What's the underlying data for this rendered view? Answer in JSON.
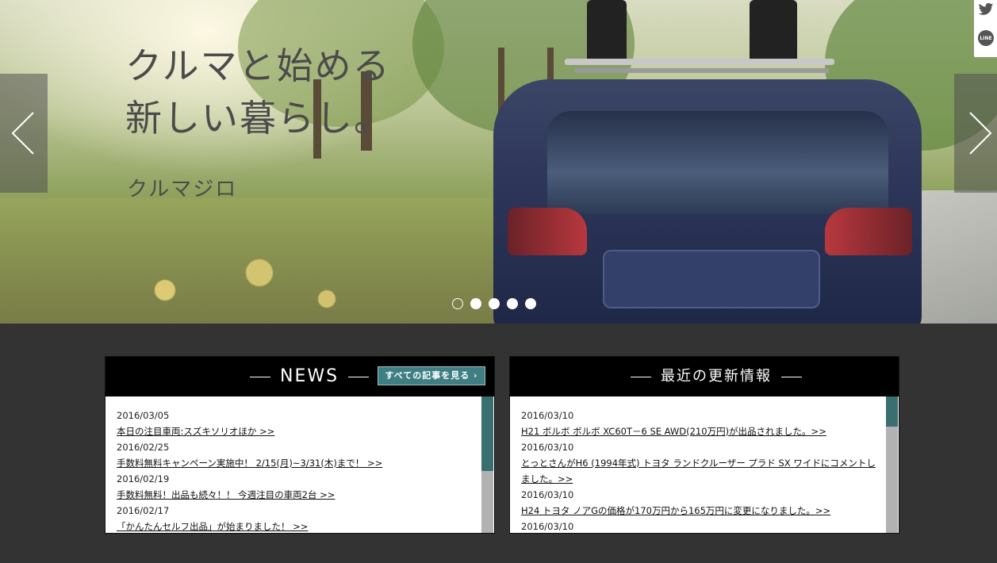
{
  "hero": {
    "headline": "クルマと始める\n新しい暮らし。",
    "brand": "クルマジロ",
    "slides": 5,
    "active_slide": 1
  },
  "social": {
    "icons": [
      "twitter-icon",
      "line-icon"
    ],
    "line_label": "LINE"
  },
  "news": {
    "title": "NEWS",
    "see_all_label": "すべての記事を見る ›",
    "entries": [
      {
        "date": "2016/03/05",
        "text": "本日の注目車両:スズキソリオほか >>"
      },
      {
        "date": "2016/02/25",
        "text": "手数料無料キャンペーン実施中！ 2/15(月)~3/31(木)まで！ >>"
      },
      {
        "date": "2016/02/19",
        "text": "手数料無料！出品も続々！！ 今週注目の車両2台 >>"
      },
      {
        "date": "2016/02/17",
        "text": "「かんたんセルフ出品」が始まりました！ >>"
      }
    ]
  },
  "updates": {
    "title": "最近の更新情報",
    "entries": [
      {
        "date": "2016/03/10",
        "text": "H21 ボルボ ボルボ XC60T－6 SE AWD(210万円)が出品されました。>>"
      },
      {
        "date": "2016/03/10",
        "text": "とっとさんがH6 (1994年式) トヨタ ランドクルーザー プラド SX ワイドにコメントしました。>>"
      },
      {
        "date": "2016/03/10",
        "text": "H24 トヨタ ノアGの価格が170万円から165万円に変更になりました。>>"
      },
      {
        "date": "2016/03/10",
        "text": ""
      }
    ]
  }
}
